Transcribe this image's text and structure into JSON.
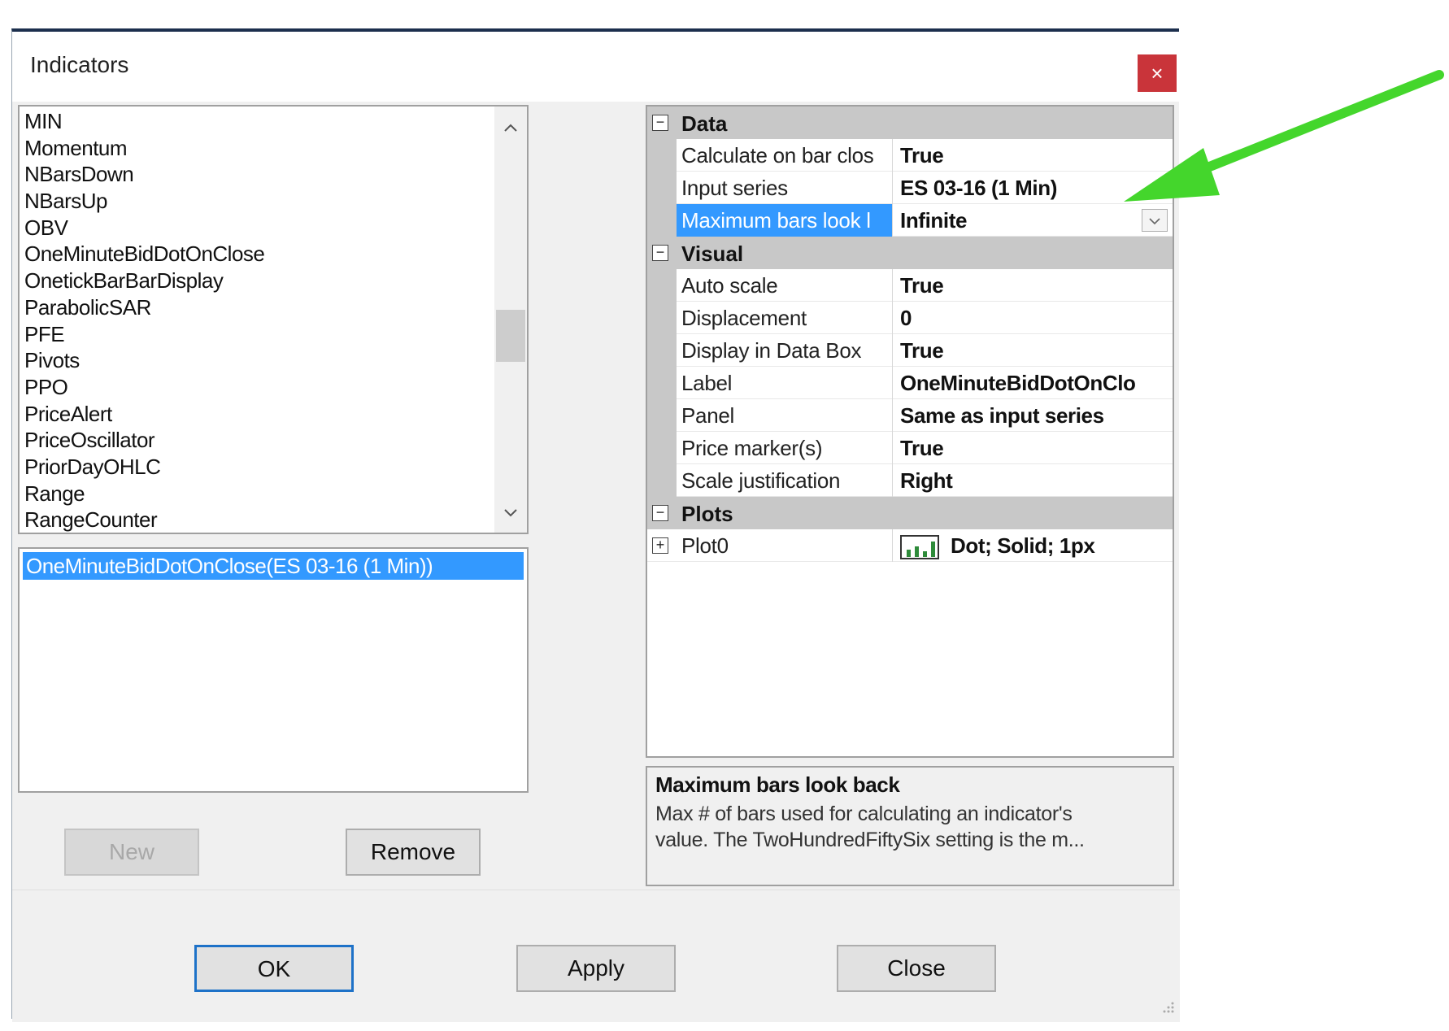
{
  "window": {
    "title": "Indicators",
    "close_glyph": "×"
  },
  "indicator_list": {
    "items": [
      "MIN",
      "Momentum",
      "NBarsDown",
      "NBarsUp",
      "OBV",
      "OneMinuteBidDotOnClose",
      "OnetickBarBarDisplay",
      "ParabolicSAR",
      "PFE",
      "Pivots",
      "PPO",
      "PriceAlert",
      "PriceOscillator",
      "PriorDayOHLC",
      "Range",
      "RangeCounter"
    ],
    "scroll_up_glyph": "^",
    "scroll_down_glyph": "v"
  },
  "applied": {
    "items": [
      "OneMinuteBidDotOnClose(ES 03-16 (1 Min))"
    ]
  },
  "buttons": {
    "new": "New",
    "remove": "Remove",
    "ok": "OK",
    "apply": "Apply",
    "close": "Close"
  },
  "properties": {
    "data": {
      "label": "Data",
      "toggle": "−",
      "rows": [
        {
          "name": "Calculate on bar clos",
          "value": "True"
        },
        {
          "name": "Input series",
          "value": "ES 03-16 (1 Min)"
        },
        {
          "name": "Maximum bars look l",
          "value": "Infinite"
        }
      ]
    },
    "visual": {
      "label": "Visual",
      "toggle": "−",
      "rows": [
        {
          "name": "Auto scale",
          "value": "True"
        },
        {
          "name": "Displacement",
          "value": "0"
        },
        {
          "name": "Display in Data Box",
          "value": "True"
        },
        {
          "name": "Label",
          "value": "OneMinuteBidDotOnClo"
        },
        {
          "name": "Panel",
          "value": "Same as input series"
        },
        {
          "name": "Price marker(s)",
          "value": "True"
        },
        {
          "name": "Scale justification",
          "value": "Right"
        }
      ]
    },
    "plots": {
      "label": "Plots",
      "toggle": "−",
      "rows": [
        {
          "name": "Plot0",
          "value": "Dot; Solid; 1px",
          "toggle": "+"
        }
      ]
    }
  },
  "description": {
    "title": "Maximum bars look back",
    "text_line1": "Max # of bars used for calculating an indicator's",
    "text_line2": "value. The TwoHundredFiftySix setting is the m..."
  },
  "colors": {
    "selection": "#3399ff",
    "annotation_arrow": "#44d62c",
    "close_button": "#c9343a"
  }
}
